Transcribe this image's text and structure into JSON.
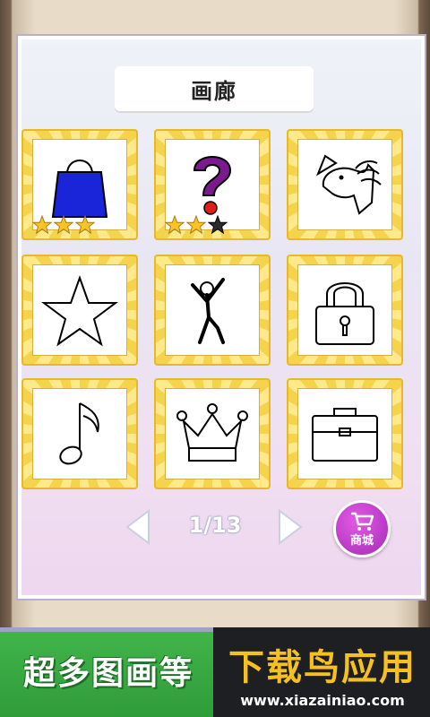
{
  "gallery": {
    "title": "画廊",
    "pager": "1/13"
  },
  "tiles": [
    {
      "name": "bag",
      "stars": [
        true,
        true,
        true
      ]
    },
    {
      "name": "question",
      "stars": [
        true,
        true,
        false
      ]
    },
    {
      "name": "unicorn",
      "stars": []
    },
    {
      "name": "star",
      "stars": []
    },
    {
      "name": "dancer",
      "stars": []
    },
    {
      "name": "lock",
      "stars": []
    },
    {
      "name": "music-note",
      "stars": []
    },
    {
      "name": "crown",
      "stars": []
    },
    {
      "name": "briefcase",
      "stars": []
    }
  ],
  "shop": {
    "label": "商城"
  },
  "banner": {
    "left_text": "超多图画等",
    "brand": "下载鸟应用",
    "url": "www.xiazainiao.com"
  },
  "colors": {
    "accent": "#a22bb5",
    "tile_gold": "#f6d34d",
    "star_gold": "#f7c423"
  }
}
